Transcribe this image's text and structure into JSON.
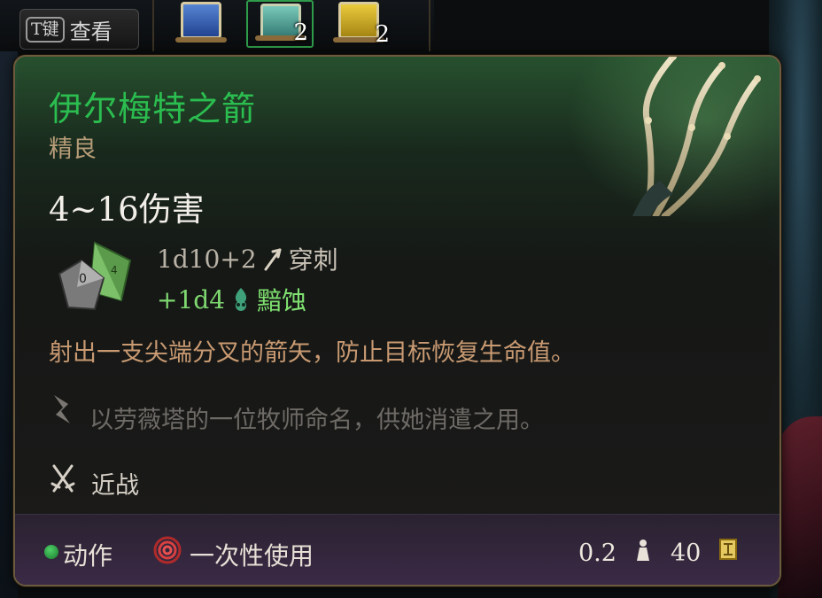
{
  "hotbar": {
    "key_hint": {
      "key": "T键",
      "label": "查看"
    },
    "slots": [
      {
        "art": "blue-scroll",
        "count": ""
      },
      {
        "art": "teal-scroll",
        "count": "2",
        "selected": true
      },
      {
        "art": "gold-scroll",
        "count": "2"
      }
    ]
  },
  "tooltip": {
    "name": "伊尔梅特之箭",
    "rarity": "精良",
    "damage_total": "4~16伤害",
    "damage_rows": [
      {
        "dice": "1d10+2",
        "icon": "arrow-icon",
        "type": "穿刺"
      },
      {
        "dice": "+1d4",
        "icon": "necrotic-skull-icon",
        "type": "黯蚀"
      }
    ],
    "description": "射出一支尖端分叉的箭矢，防止目标恢复生命值。",
    "lore": "以劳薇塔的一位牧师命名，供她消遣之用。",
    "attack_type": "近战",
    "footer": {
      "action": "动作",
      "usage": "一次性使用",
      "weight": "0.2",
      "price": "40"
    }
  },
  "colors": {
    "item_name": "#2bbd4f",
    "rarity": "#b69c78",
    "extra_damage": "#7fd870",
    "description": "#c99a72",
    "lore": "#6e6a66",
    "action_dot": "#2fa848"
  }
}
